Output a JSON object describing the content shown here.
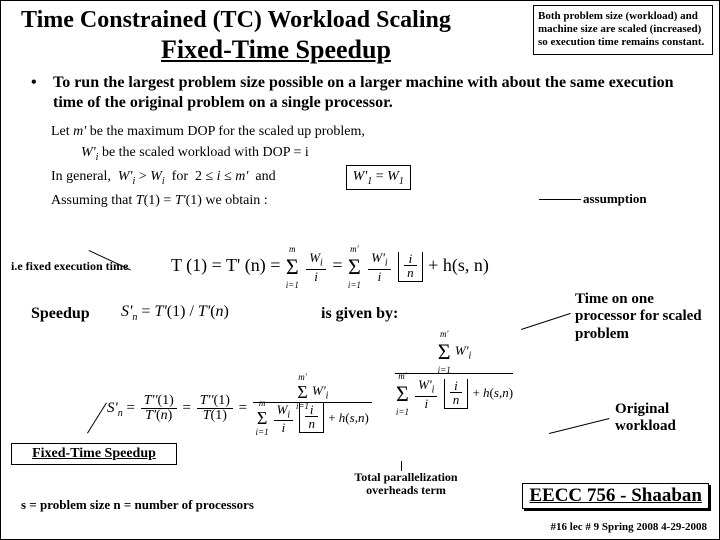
{
  "title": {
    "line1": "Time Constrained (TC) Workload Scaling",
    "line2": "Fixed-Time Speedup"
  },
  "note_box": "Both problem size (workload) and machine size are scaled (increased) so execution time remains constant.",
  "bullet": "To run the largest problem size possible on a larger machine with about the same execution time of the original problem on a single processor.",
  "derivation": {
    "l1_a": "Let ",
    "l1_b": "m'",
    "l1_c": " be the maximum DOP for the scaled up problem,",
    "l2_a": "W'",
    "l2_sub": "i",
    "l2_b": " be the scaled workload with DOP = i",
    "l3": "In general,  W'_i > W_i  for  2 ≤ i ≤ m'  and",
    "l3_box": "W'₁ = W₁",
    "l4": "Assuming that T(1) = T'(1) we obtain :"
  },
  "labels": {
    "assumption": "assumption",
    "exectime": "i.e fixed execution time",
    "speedup": "Speedup",
    "isgiven": "is given by:",
    "time_on_one": "Time on one processor for scaled problem",
    "orig_work": "Original workload",
    "fts": "Fixed-Time Speedup",
    "overheads": "Total parallelization overheads term",
    "sn": "s = problem size   n = number of processors"
  },
  "eq": {
    "main_lhs": "T (1) = T' (n) =",
    "sum1_top": "m",
    "sum1_bot": "i=1",
    "sum2_top": "m'",
    "sum2_bot": "i=1",
    "frac_wi_n": "W_i",
    "frac_wi_d": "i",
    "frac_wpi_n": "W'_i",
    "frac_wpi_d": "i",
    "floor_n": "i",
    "floor_d": "n",
    "plus_h": " + h(s, n)",
    "speedup_eq": "S'_n = T'(1) / T'(n)",
    "big_num_sum_top": "m'",
    "big_num_sum_bot": "i=1",
    "big_num_frac": "W'_i",
    "big_lhs": "S'_n =",
    "big_mid1": "T''(1)",
    "big_mid2": "T'(n)",
    "big_mid3": "T''(1)",
    "big_mid4": "T(1)"
  },
  "footer": {
    "course": "EECC 756 - Shaaban",
    "meta": "#16  lec # 9   Spring 2008  4-29-2008"
  }
}
